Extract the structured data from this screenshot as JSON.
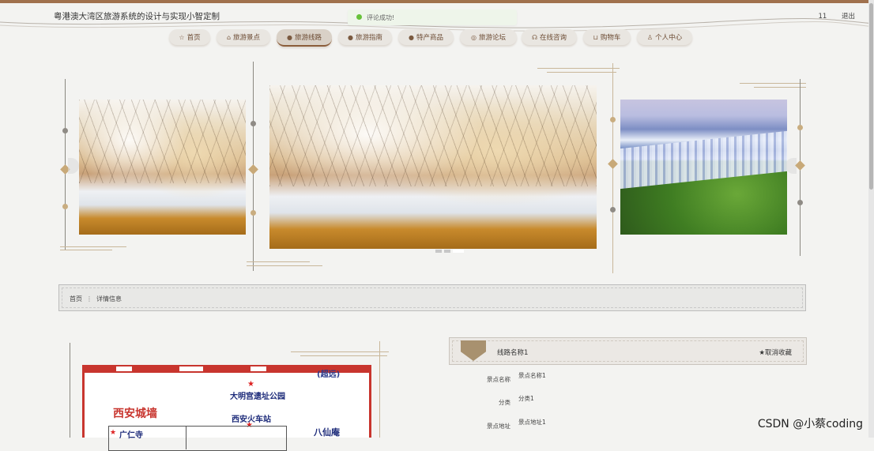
{
  "header": {
    "site_title": "粤港澳大湾区旅游系统的设计与实现小智定制",
    "user": "11",
    "logout": "退出"
  },
  "toast": {
    "message": "评论成功!"
  },
  "nav": [
    {
      "label": "首页",
      "icon": "home-icon",
      "glyph": "☆"
    },
    {
      "label": "旅游景点",
      "icon": "bag-icon",
      "glyph": "⌂"
    },
    {
      "label": "旅游线路",
      "icon": "route-icon",
      "glyph": "●"
    },
    {
      "label": "旅游指南",
      "icon": "question-icon",
      "glyph": "●"
    },
    {
      "label": "特产商品",
      "icon": "info-icon",
      "glyph": "●"
    },
    {
      "label": "旅游论坛",
      "icon": "forum-icon",
      "glyph": "◎"
    },
    {
      "label": "在线咨询",
      "icon": "headset-icon",
      "glyph": "☊"
    },
    {
      "label": "购物车",
      "icon": "cart-icon",
      "glyph": "⊔"
    },
    {
      "label": "个人中心",
      "icon": "user-icon",
      "glyph": "♙"
    }
  ],
  "breadcrumb": {
    "home": "首页",
    "separator": "⋮",
    "current": "详情信息"
  },
  "map": {
    "top_right": "(超远)",
    "poi1": "大明宫遗址公园",
    "city_wall": "西安城墙",
    "station": "西安火车站",
    "temple": "广仁寺",
    "baxian": "八仙庵"
  },
  "detail": {
    "route_name": "线路名称1",
    "cancel_fav": "★取消收藏",
    "rows": [
      {
        "key": "景点名称",
        "value": "景点名称1"
      },
      {
        "key": "分类",
        "value": "分类1"
      },
      {
        "key": "景点地址",
        "value": "景点地址1"
      }
    ]
  },
  "watermark": "CSDN @小蔡coding",
  "colors": {
    "accent": "#a0714d",
    "map_red": "#c8352e",
    "toast_dot": "#67c23a"
  }
}
